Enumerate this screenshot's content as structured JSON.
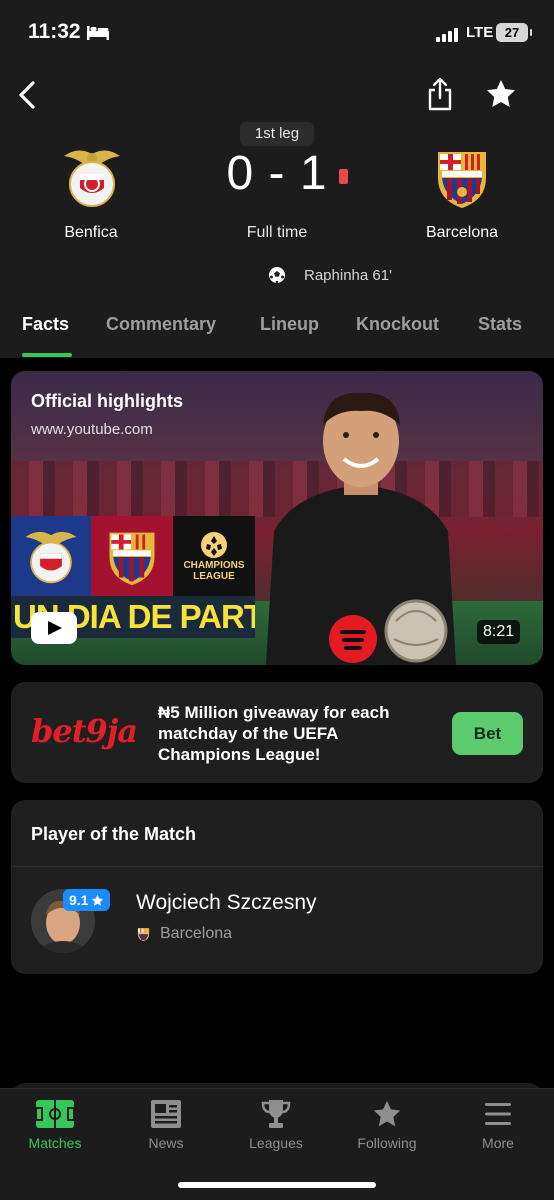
{
  "status_bar": {
    "time": "11:32",
    "network": "LTE",
    "battery": "27"
  },
  "match": {
    "leg": "1st leg",
    "home_team": "Benfica",
    "away_team": "Barcelona",
    "score": "0 - 1",
    "status": "Full time",
    "scorer": "Raphinha 61'"
  },
  "tabs": [
    "Facts",
    "Commentary",
    "Lineup",
    "Knockout",
    "Stats"
  ],
  "highlights": {
    "title": "Official highlights",
    "url": "www.youtube.com",
    "banner_text": "UN DIA DE PARTIT",
    "duration": "8:21",
    "cl_label": "CHAMPIONS LEAGUE"
  },
  "ad": {
    "brand": "bet9ja",
    "text": "₦5 Million giveaway for each matchday of the UEFA Champions League!",
    "button": "Bet"
  },
  "player_of_match": {
    "heading": "Player of the Match",
    "rating": "9.1",
    "name": "Wojciech Szczesny",
    "club": "Barcelona"
  },
  "nav": [
    {
      "label": "Matches",
      "icon": "pitch-icon",
      "active": true
    },
    {
      "label": "News",
      "icon": "newspaper-icon",
      "active": false
    },
    {
      "label": "Leagues",
      "icon": "trophy-icon",
      "active": false
    },
    {
      "label": "Following",
      "icon": "star-icon",
      "active": false
    },
    {
      "label": "More",
      "icon": "menu-icon",
      "active": false
    }
  ],
  "colors": {
    "accent": "#34c759",
    "background": "#000000",
    "card": "#1f1f1f",
    "rating": "#1a8cff"
  }
}
